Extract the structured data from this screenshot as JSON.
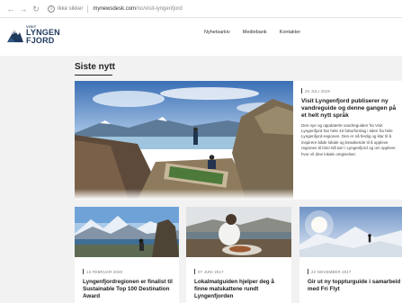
{
  "browser": {
    "back_icon": "arrow-left-icon",
    "forward_icon": "arrow-right-icon",
    "reload_icon": "reload-icon",
    "security_label": "Ikke sikker",
    "url_domain": "mynewsdesk.com",
    "url_path": "/no/visit-lyngenfjord"
  },
  "logo": {
    "line1": "VISIT",
    "line2": "LYNGEN",
    "line3": "FJORD",
    "color": "#1f3a5e"
  },
  "nav": {
    "items": [
      "Nyhetsarkiv",
      "Mediebank",
      "Kontakter"
    ]
  },
  "section": {
    "title": "Siste nytt"
  },
  "hero": {
    "date": "26 JULI 2019",
    "title": "Visit Lyngenfjord publiserer ny vandreguide og denne gangen på et helt nytt språk",
    "body": "Den nye og oppdaterte vandreguiden fra Visit Lyngenfjord har hele 43 fotturforslag i tiden fra hele Lyngenfjord-regionen. Den er nå ferdig og klar til å inspirere både lokale og besøkende til å oppleve regionen til fots! Nå tørr i Lyngenfjord og om oppleve hvor vil dine lokale omgivelser."
  },
  "cards": [
    {
      "date": "13 FEBRUAR 2020",
      "title": "Lyngenfjordregionen er finalist til Sustainable Top 100 Destination Award"
    },
    {
      "date": "07 JUNI 2017",
      "title": "Lokalmatguiden hjelper deg å finne matskattene rundt Lyngenfjorden"
    },
    {
      "date": "22 NOVEMBER 2017",
      "title": "Gir ut ny toppturguide i samarbeid med Fri Flyt"
    }
  ]
}
